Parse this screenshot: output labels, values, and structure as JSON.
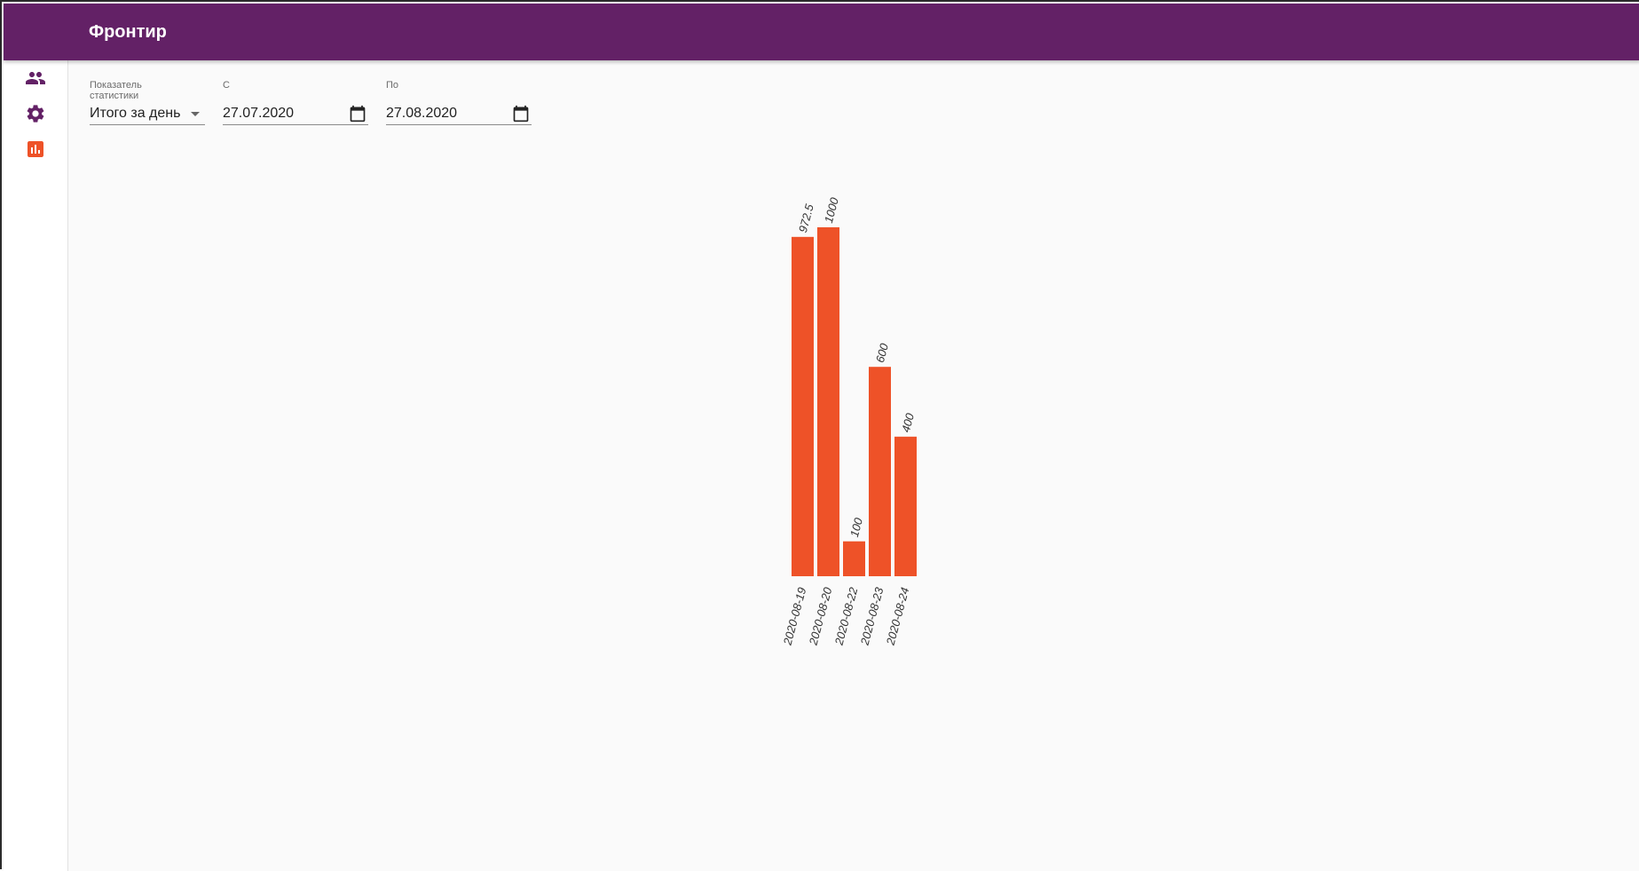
{
  "app": {
    "title": "Фронтир"
  },
  "sidebar": {
    "items": [
      {
        "name": "users",
        "icon": "users-icon",
        "active": false
      },
      {
        "name": "settings",
        "icon": "gear-icon",
        "active": false
      },
      {
        "name": "statistics",
        "icon": "bar-chart-icon",
        "active": true
      }
    ]
  },
  "filters": {
    "metric": {
      "label": "Показатель\nстатистики",
      "value": "Итого за день"
    },
    "from": {
      "label": "С",
      "value": "27.07.2020"
    },
    "to": {
      "label": "По",
      "value": "27.08.2020"
    }
  },
  "colors": {
    "appbar": "#632166",
    "nav_icon": "#632166",
    "nav_icon_active": "#EE5228",
    "bar": "#EE5228"
  },
  "chart_data": {
    "type": "bar",
    "categories": [
      "2020-08-19",
      "2020-08-20",
      "2020-08-22",
      "2020-08-23",
      "2020-08-24"
    ],
    "values": [
      972.5,
      1000,
      100,
      600,
      400
    ],
    "value_labels": [
      "972.5",
      "1000",
      "100",
      "600",
      "400"
    ],
    "ylim": [
      0,
      1000
    ],
    "grid": false,
    "axis_lines": false
  }
}
